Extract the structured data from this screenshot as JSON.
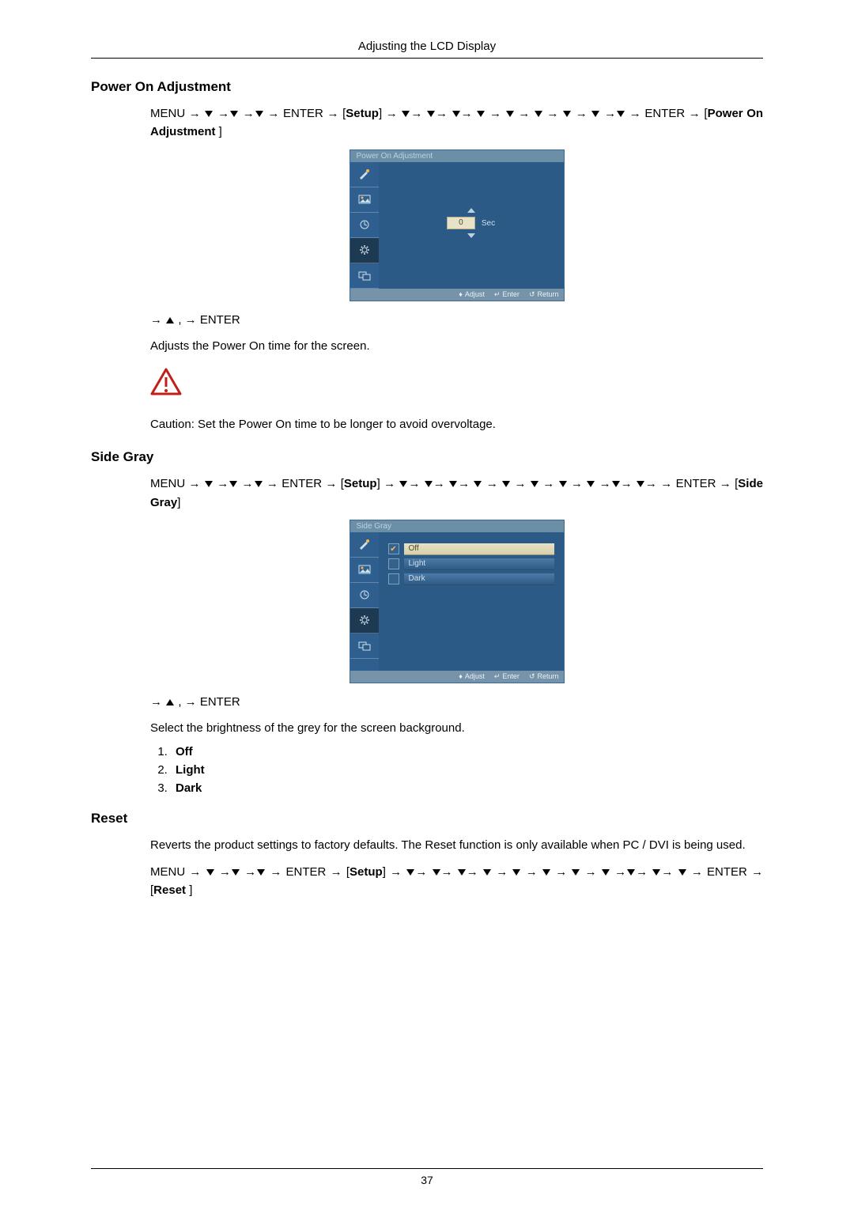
{
  "header": {
    "title": "Adjusting the LCD Display"
  },
  "sec1": {
    "title": "Power On Adjustment",
    "nav1_pre": "MENU → ",
    "nav1_enter1": " → ENTER → [",
    "nav1_setup": "Setup",
    "nav1_mid": "] → ",
    "nav1_enter2": " → ENTER → [",
    "nav1_label": "Power On Adjustment",
    "nav1_end": " ]",
    "osd_title": "Power On Adjustment",
    "osd_value": "0",
    "osd_unit": "Sec",
    "footer_adjust": "Adjust",
    "footer_enter": "Enter",
    "footer_return": "Return",
    "nav2": " ,  → ENTER",
    "desc": "Adjusts the Power On time for the screen.",
    "caution": "Caution: Set the Power On time to be longer to avoid overvoltage."
  },
  "sec2": {
    "title": "Side Gray",
    "nav1_pre": "MENU → ",
    "nav1_enter1": " → ENTER → [",
    "nav1_setup": "Setup",
    "nav1_mid": "] → ",
    "nav1_enter2": " → ENTER → [",
    "nav1_label": "Side Gray",
    "nav1_end": "]",
    "osd_title": "Side Gray",
    "opt1": "Off",
    "opt2": "Light",
    "opt3": "Dark",
    "footer_adjust": "Adjust",
    "footer_enter": "Enter",
    "footer_return": "Return",
    "nav2": " ,  → ENTER",
    "desc": "Select the brightness of the grey for the screen background.",
    "list1": "Off",
    "list2": "Light",
    "list3": "Dark"
  },
  "sec3": {
    "title": "Reset",
    "desc": "Reverts the product settings to factory defaults. The Reset function is only available when PC / DVI is being used.",
    "nav1_pre": "MENU → ",
    "nav1_enter1": " → ENTER → [",
    "nav1_setup": "Setup",
    "nav1_mid": "] → ",
    "nav1_enter2": " → ENTER → [",
    "nav1_label": "Reset",
    "nav1_end": " ]"
  },
  "page_number": "37"
}
